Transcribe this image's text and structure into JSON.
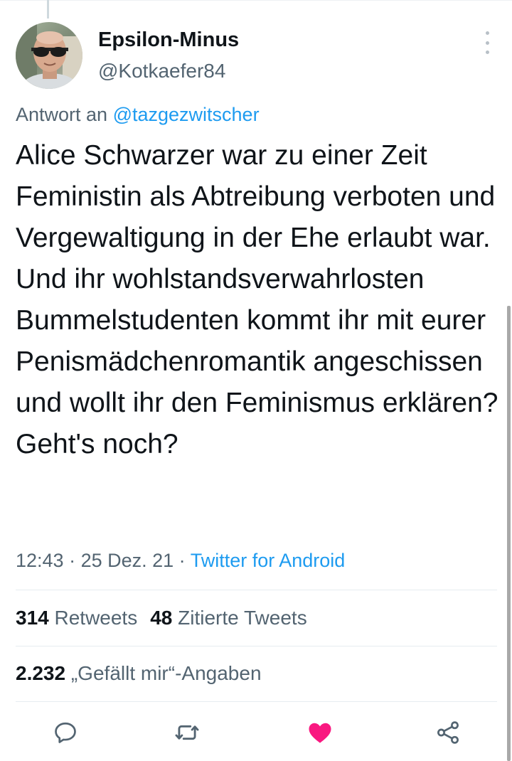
{
  "user": {
    "display_name": "Epsilon-Minus",
    "handle": "@Kotkaefer84"
  },
  "reply": {
    "prefix": "Antwort an ",
    "mention": "@tazgezwitscher"
  },
  "tweet": {
    "text": "Alice Schwarzer war zu einer Zeit Feministin als Abtreibung verboten und Vergewaltigung in der Ehe erlaubt war. Und ihr wohlstandsverwahrlosten Bummelstudenten kommt ihr mit eurer Penismädchenromantik angeschissen und wollt ihr den Feminismus erklären? Geht's noch?",
    "time": "12:43",
    "separator": " · ",
    "date": "25 Dez. 21",
    "source": "Twitter for Android"
  },
  "stats": {
    "retweets_count": "314",
    "retweets_label": " Retweets",
    "quotes_count": "48",
    "quotes_label": " Zitierte Tweets",
    "likes_count": "2.232",
    "likes_label": " „Gefällt mir“-Angaben"
  },
  "actions": [
    {
      "icon": "reply-icon"
    },
    {
      "icon": "retweet-icon"
    },
    {
      "icon": "like-icon",
      "active": true
    },
    {
      "icon": "share-icon"
    }
  ],
  "colors": {
    "accent": "#1d9bf0",
    "like": "#f91880",
    "text": "#0f1419",
    "secondary": "#536471"
  }
}
